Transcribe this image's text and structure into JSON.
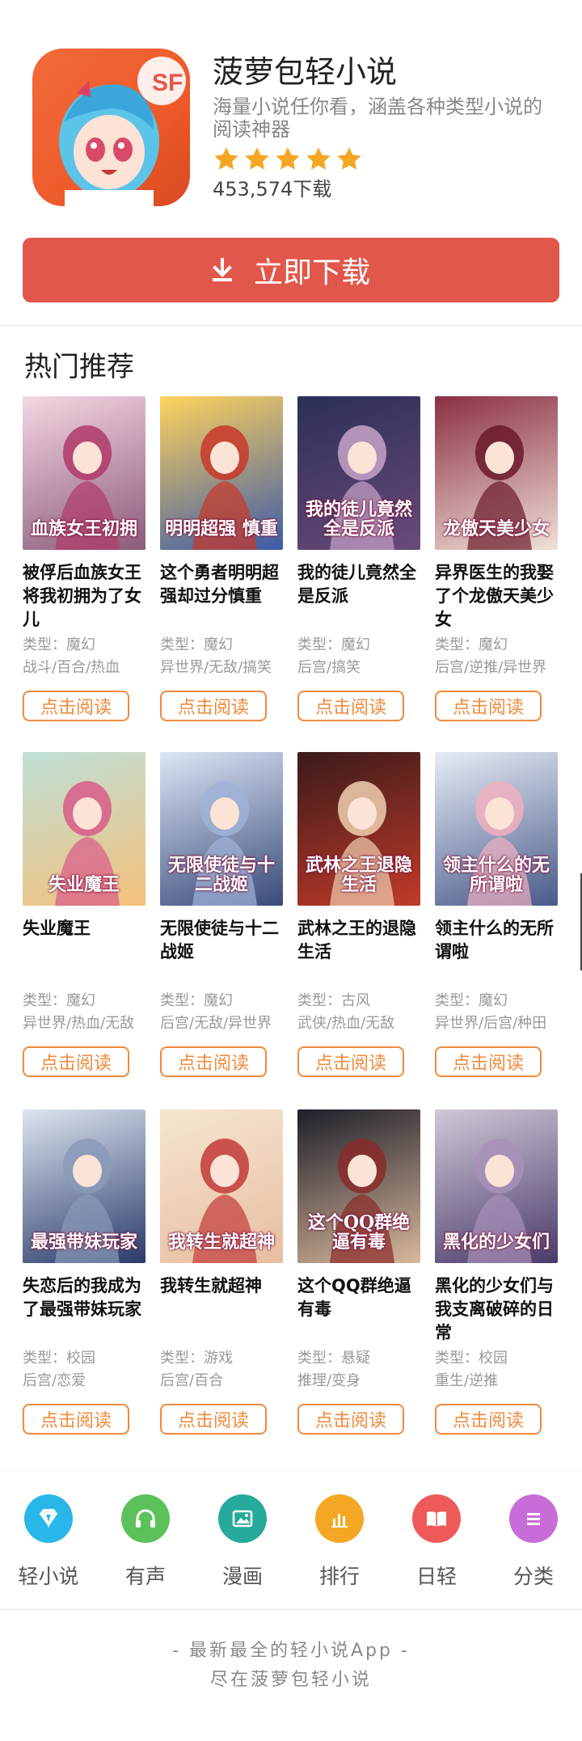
{
  "app": {
    "name": "菠萝包轻小说",
    "description": "海量小说任你看，涵盖各种类型小说的阅读神器",
    "rating": 5,
    "downloads": "453,574下载",
    "download_button": "立即下载",
    "icon_text": "SF"
  },
  "section": {
    "title": "热门推荐"
  },
  "books": [
    {
      "title": "被俘后血族女王将我初拥为了女儿",
      "type": "类型：魔幻",
      "tags": "战斗/百合/热血",
      "cover_text": "血族女王初拥",
      "read_label": "点击阅读"
    },
    {
      "title": "这个勇者明明超强却过分慎重",
      "type": "类型：魔幻",
      "tags": "异世界/无敌/搞笑",
      "cover_text": "明明超强 慎重",
      "read_label": "点击阅读"
    },
    {
      "title": "我的徒儿竟然全是反派",
      "type": "类型：魔幻",
      "tags": "后宫/搞笑",
      "cover_text": "我的徒儿竟然全是反派",
      "read_label": "点击阅读"
    },
    {
      "title": "异界医生的我娶了个龙傲天美少女",
      "type": "类型：魔幻",
      "tags": "后宫/逆推/异世界",
      "cover_text": "龙傲天美少女",
      "read_label": "点击阅读"
    },
    {
      "title": "失业魔王",
      "type": "类型：魔幻",
      "tags": "异世界/热血/无敌",
      "cover_text": "失业魔王",
      "read_label": "点击阅读"
    },
    {
      "title": "无限使徒与十二战姬",
      "type": "类型：魔幻",
      "tags": "后宫/无敌/异世界",
      "cover_text": "无限使徒与十二战姬",
      "read_label": "点击阅读"
    },
    {
      "title": "武林之王的退隐生活",
      "type": "类型：古风",
      "tags": "武侠/热血/无敌",
      "cover_text": "武林之王退隐生活",
      "read_label": "点击阅读"
    },
    {
      "title": "领主什么的无所谓啦",
      "type": "类型：魔幻",
      "tags": "异世界/后宫/种田",
      "cover_text": "领主什么的无所谓啦",
      "read_label": "点击阅读"
    },
    {
      "title": "失恋后的我成为了最强带妹玩家",
      "type": "类型：校园",
      "tags": "后宫/恋爱",
      "cover_text": "最强带妹玩家",
      "read_label": "点击阅读"
    },
    {
      "title": "我转生就超神",
      "type": "类型：游戏",
      "tags": "后宫/百合",
      "cover_text": "我转生就超神",
      "read_label": "点击阅读"
    },
    {
      "title": "这个QQ群绝逼有毒",
      "type": "类型：悬疑",
      "tags": "推理/变身",
      "cover_text": "这个QQ群绝逼有毒",
      "read_label": "点击阅读"
    },
    {
      "title": "黑化的少女们与我支离破碎的日常",
      "type": "类型：校园",
      "tags": "重生/逆推",
      "cover_text": "黑化的少女们",
      "read_label": "点击阅读"
    }
  ],
  "nav": [
    {
      "label": "轻小说",
      "icon": "diamond-icon",
      "color": "#29b6e8"
    },
    {
      "label": "有声",
      "icon": "headphones-icon",
      "color": "#5cc15a"
    },
    {
      "label": "漫画",
      "icon": "image-icon",
      "color": "#27a99c"
    },
    {
      "label": "排行",
      "icon": "bar-chart-icon",
      "color": "#f5a623"
    },
    {
      "label": "日轻",
      "icon": "book-icon",
      "color": "#ee5a5a"
    },
    {
      "label": "分类",
      "icon": "list-icon",
      "color": "#c86dd7"
    }
  ],
  "footer": {
    "line1": "- 最新最全的轻小说App -",
    "line2": "尽在菠萝包轻小说"
  },
  "colors": {
    "accent": "#e2574b",
    "read_button": "#f08a3c",
    "star": "#f5a623"
  }
}
